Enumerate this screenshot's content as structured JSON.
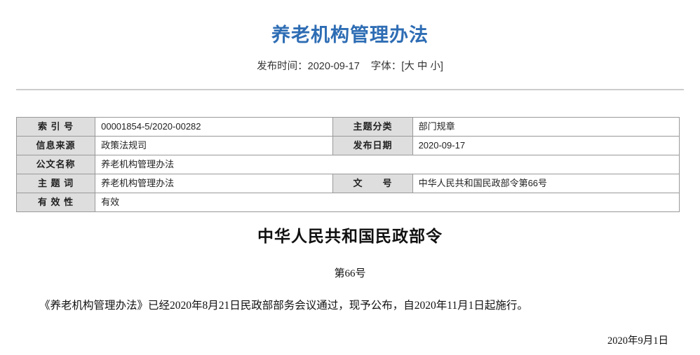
{
  "header": {
    "title": "养老机构管理办法",
    "publish_label": "发布时间：",
    "publish_date": "2020-09-17",
    "font_label": "字体：",
    "font_bracket_open": "[",
    "font_size_large": "大",
    "font_size_medium": "中",
    "font_size_small": "小",
    "font_bracket_close": "]"
  },
  "meta_table": {
    "rows": [
      {
        "label_left": "索 引 号",
        "value_left": "00001854-5/2020-00282",
        "label_right": "主题分类",
        "value_right": "部门规章"
      },
      {
        "label_left": "信息来源",
        "value_left": "政策法规司",
        "label_right": "发布日期",
        "value_right": "2020-09-17"
      },
      {
        "label_left": "公文名称",
        "value_left": "养老机构管理办法",
        "label_right": "",
        "value_right": ""
      },
      {
        "label_left": "主 题 词",
        "value_left": "养老机构管理办法",
        "label_right": "文　　号",
        "value_right": "中华人民共和国民政部令第66号"
      },
      {
        "label_left": "有 效 性",
        "value_left": "有效",
        "label_right": "",
        "value_right": ""
      }
    ]
  },
  "document": {
    "order_heading": "中华人民共和国民政部令",
    "order_number": "第66号",
    "paragraph": "《养老机构管理办法》已经2020年8月21日民政部部务会议通过，现予公布，自2020年11月1日起施行。",
    "signature_date": "2020年9月1日"
  },
  "colors": {
    "title_blue": "#2E6DB4",
    "table_label_bg": "#dedede",
    "table_border": "#999999",
    "divider": "#cccccc"
  }
}
